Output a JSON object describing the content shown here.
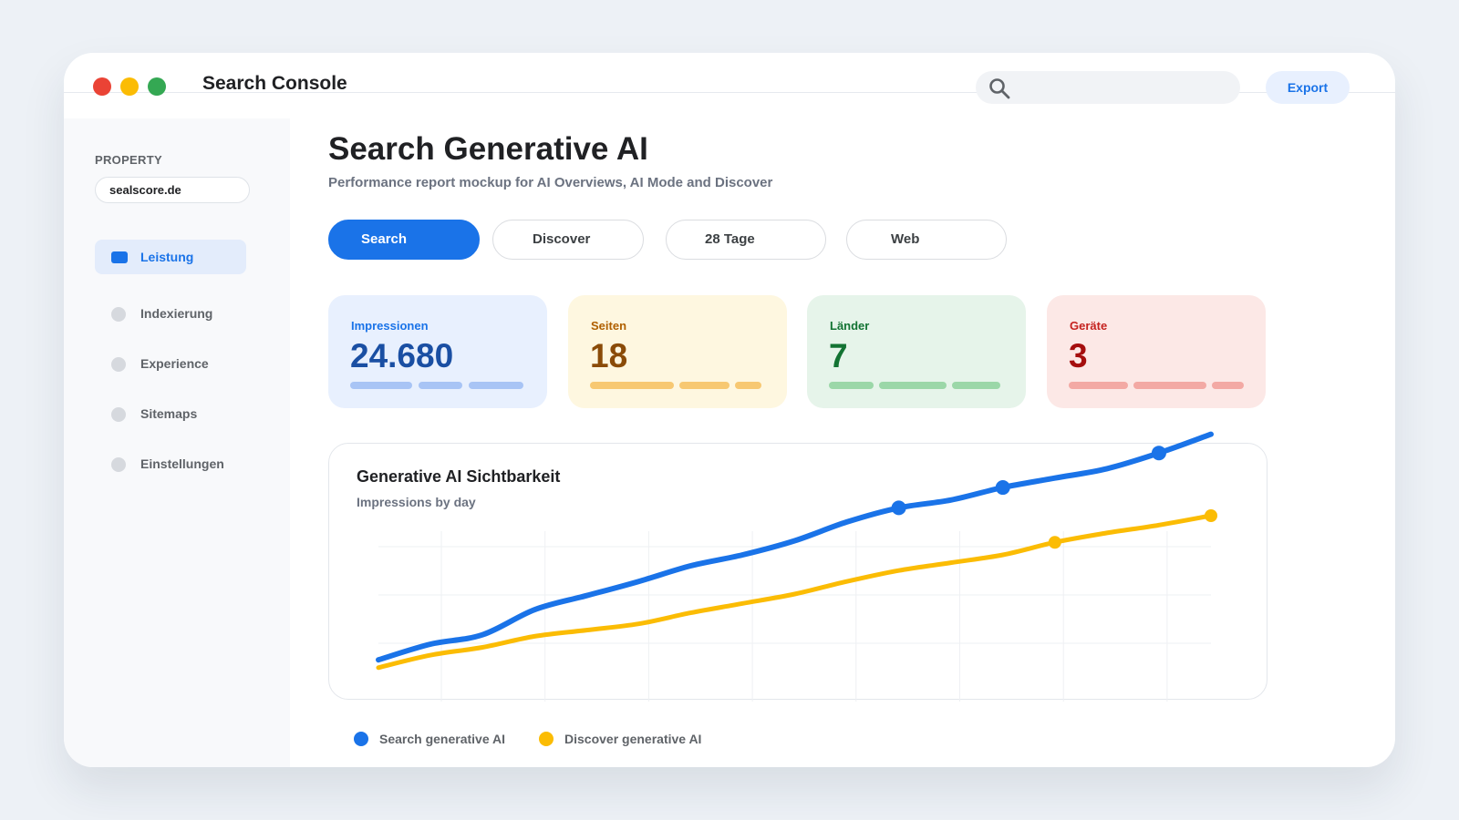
{
  "app": {
    "title": "Search Console",
    "search_placeholder": "",
    "export_label": "Export"
  },
  "sidebar": {
    "property_label": "PROPERTY",
    "property_value": "sealscore.de",
    "items": [
      {
        "label": "Leistung",
        "active": true
      },
      {
        "label": "Indexierung",
        "active": false
      },
      {
        "label": "Experience",
        "active": false
      },
      {
        "label": "Sitemaps",
        "active": false
      },
      {
        "label": "Einstellungen",
        "active": false
      }
    ]
  },
  "main": {
    "title": "Search Generative AI",
    "subtitle": "Performance report mockup for AI Overviews, AI Mode and Discover",
    "filters": [
      {
        "label": "Search",
        "active": true
      },
      {
        "label": "Discover",
        "active": false
      },
      {
        "label": "28 Tage",
        "active": false
      },
      {
        "label": "Web",
        "active": false
      }
    ],
    "cards": [
      {
        "label": "Impressionen",
        "value": "24.680",
        "bg": "#e8f0fe",
        "fg": "#1a4fa3",
        "label_color": "#1a73e8",
        "bar": "#a8c4f5"
      },
      {
        "label": "Seiten",
        "value": "18",
        "bg": "#fef7e0",
        "fg": "#8a4b08",
        "label_color": "#b06000",
        "bar": "#f7c872"
      },
      {
        "label": "Länder",
        "value": "7",
        "bg": "#e6f4ea",
        "fg": "#137333",
        "label_color": "#137333",
        "bar": "#9bd7a8"
      },
      {
        "label": "Geräte",
        "value": "3",
        "bg": "#fce8e6",
        "fg": "#a50e0e",
        "label_color": "#c5221f",
        "bar": "#f3a9a4"
      }
    ]
  },
  "chart": {
    "title": "Generative AI Sichtbarkeit",
    "subtitle": "Impressions by day",
    "legend": [
      {
        "name": "Search generative AI",
        "color": "#1a73e8"
      },
      {
        "name": "Discover generative AI",
        "color": "#fbbc04"
      }
    ]
  },
  "chart_data": {
    "type": "line",
    "title": "Generative AI Sichtbarkeit",
    "subtitle": "Impressions by day",
    "x": [
      0,
      1,
      2,
      3,
      4,
      5,
      6,
      7,
      8,
      9,
      10,
      11,
      12,
      13,
      14,
      15,
      16
    ],
    "ylim": [
      0,
      100
    ],
    "grid": true,
    "legend_position": "bottom-left",
    "series": [
      {
        "name": "Search generative AI",
        "color": "#1a73e8",
        "values": [
          8,
          18,
          24,
          40,
          49,
          58,
          68,
          75,
          84,
          96,
          105,
          110,
          118,
          124,
          130,
          140,
          152
        ],
        "markers": [
          10,
          12,
          15
        ]
      },
      {
        "name": "Discover generative AI",
        "color": "#fbbc04",
        "values": [
          3,
          11,
          16,
          23,
          27,
          31,
          38,
          44,
          50,
          58,
          65,
          70,
          75,
          83,
          89,
          94,
          100
        ],
        "markers": [
          13,
          16
        ]
      }
    ]
  }
}
